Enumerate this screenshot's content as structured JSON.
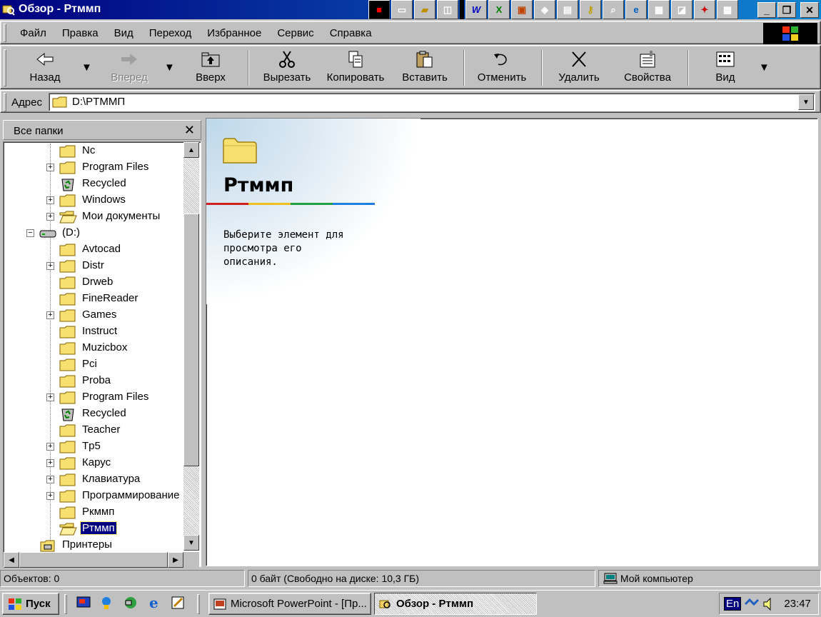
{
  "window": {
    "title": "Обзор - Ртммп"
  },
  "menu": [
    "Файл",
    "Правка",
    "Вид",
    "Переход",
    "Избранное",
    "Сервис",
    "Справка"
  ],
  "toolbar": {
    "back": "Назад",
    "forward": "Вперед",
    "up": "Вверх",
    "cut": "Вырезать",
    "copy": "Копировать",
    "paste": "Вставить",
    "undo": "Отменить",
    "delete": "Удалить",
    "properties": "Свойства",
    "view": "Вид"
  },
  "address": {
    "label": "Адрес",
    "value": "D:\\PTMMП"
  },
  "tree": {
    "header": "Все папки",
    "items": [
      {
        "label": "Nc",
        "expand": false,
        "icon": "folder-icon",
        "level": 2
      },
      {
        "label": "Program Files",
        "expand": true,
        "icon": "folder-icon",
        "level": 2
      },
      {
        "label": "Recycled",
        "expand": false,
        "icon": "recycle-bin-icon",
        "level": 2
      },
      {
        "label": "Windows",
        "expand": true,
        "icon": "folder-icon",
        "level": 2
      },
      {
        "label": "Мои документы",
        "expand": true,
        "icon": "folder-open-icon",
        "level": 2
      },
      {
        "label": "(D:)",
        "expand": "minus",
        "icon": "drive-icon",
        "level": 1
      },
      {
        "label": "Avtocad",
        "expand": false,
        "icon": "folder-icon",
        "level": 2
      },
      {
        "label": "Distr",
        "expand": true,
        "icon": "folder-icon",
        "level": 2
      },
      {
        "label": "Drweb",
        "expand": false,
        "icon": "folder-icon",
        "level": 2
      },
      {
        "label": "FineReader",
        "expand": false,
        "icon": "folder-icon",
        "level": 2
      },
      {
        "label": "Games",
        "expand": true,
        "icon": "folder-icon",
        "level": 2
      },
      {
        "label": "Instruct",
        "expand": false,
        "icon": "folder-icon",
        "level": 2
      },
      {
        "label": "Muzicbox",
        "expand": false,
        "icon": "folder-icon",
        "level": 2
      },
      {
        "label": "Pci",
        "expand": false,
        "icon": "folder-icon",
        "level": 2
      },
      {
        "label": "Proba",
        "expand": false,
        "icon": "folder-icon",
        "level": 2
      },
      {
        "label": "Program Files",
        "expand": true,
        "icon": "folder-icon",
        "level": 2
      },
      {
        "label": "Recycled",
        "expand": false,
        "icon": "recycle-bin-icon",
        "level": 2
      },
      {
        "label": "Teacher",
        "expand": false,
        "icon": "folder-icon",
        "level": 2
      },
      {
        "label": "Tp5",
        "expand": true,
        "icon": "folder-icon",
        "level": 2
      },
      {
        "label": "Карус",
        "expand": true,
        "icon": "folder-icon",
        "level": 2
      },
      {
        "label": "Клавиатура",
        "expand": true,
        "icon": "folder-icon",
        "level": 2
      },
      {
        "label": "Программирование",
        "expand": true,
        "icon": "folder-icon",
        "level": 2
      },
      {
        "label": "Ркммп",
        "expand": false,
        "icon": "folder-icon",
        "level": 2
      },
      {
        "label": "Ртммп",
        "expand": false,
        "icon": "folder-open-icon",
        "level": 2,
        "selected": true
      },
      {
        "label": "Принтеры",
        "expand": false,
        "icon": "printers-icon",
        "level": 1
      }
    ]
  },
  "content": {
    "title": "Ртммп",
    "description": "Выберите элемент для просмотра его описания."
  },
  "status": {
    "objects": "Объектов: 0",
    "size": "0 байт (Свободно на диске: 10,3 ГБ)",
    "location": "Мой компьютер"
  },
  "taskbar": {
    "start": "Пуск",
    "tasks": [
      "Microsoft PowerPoint - [Пр...",
      "Обзор - Ртммп"
    ],
    "lang": "En",
    "clock": "23:47"
  }
}
